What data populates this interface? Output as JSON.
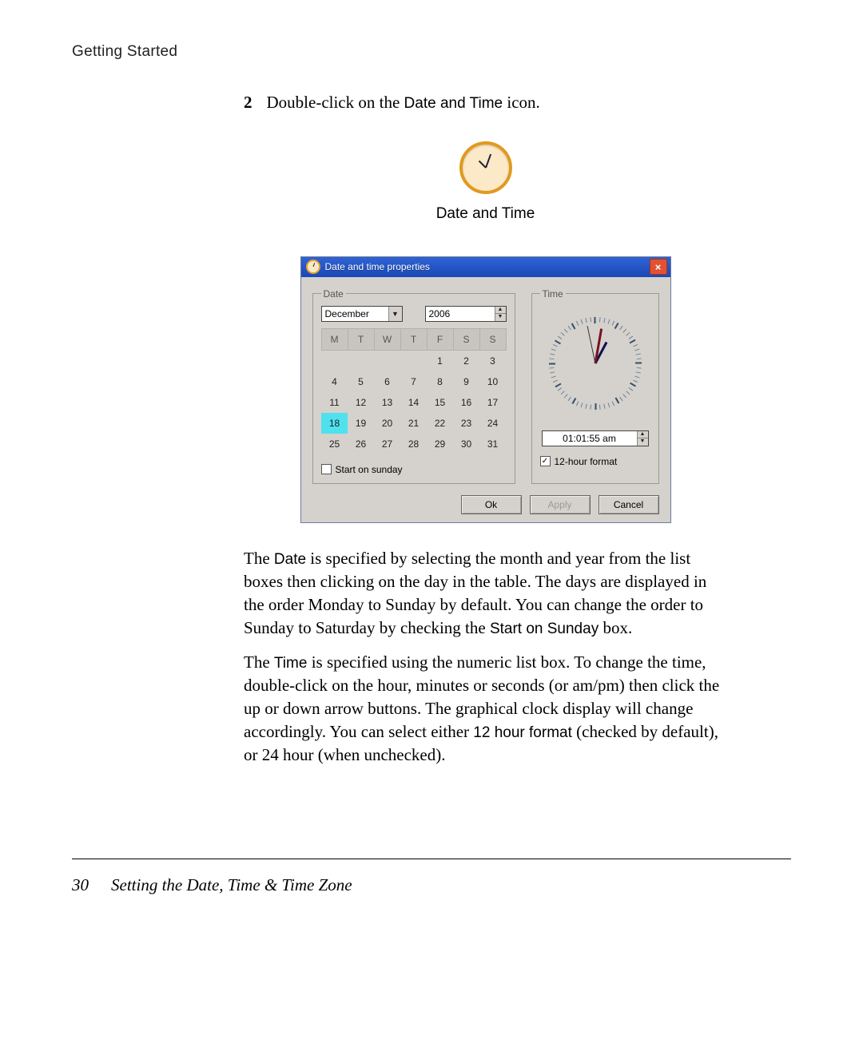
{
  "header": "Getting Started",
  "step_num": "2",
  "step_text_a": "Double-click on the ",
  "step_ui": "Date and Time",
  "step_text_b": " icon.",
  "icon_caption": "Date and Time",
  "dialog": {
    "title": "Date and time properties",
    "close": "×",
    "date_legend": "Date",
    "time_legend": "Time",
    "month": "December",
    "year": "2006",
    "dow": [
      "M",
      "T",
      "W",
      "T",
      "F",
      "S",
      "S"
    ],
    "weeks": [
      [
        "",
        "",
        "",
        "",
        "1",
        "2",
        "3"
      ],
      [
        "4",
        "5",
        "6",
        "7",
        "8",
        "9",
        "10"
      ],
      [
        "11",
        "12",
        "13",
        "14",
        "15",
        "16",
        "17"
      ],
      [
        "18",
        "19",
        "20",
        "21",
        "22",
        "23",
        "24"
      ],
      [
        "25",
        "26",
        "27",
        "28",
        "29",
        "30",
        "31"
      ]
    ],
    "selected_day": "18",
    "start_sunday_label": "Start on sunday",
    "start_sunday_checked": false,
    "time_value": "01:01:55 am",
    "twelve_label": "12-hour format",
    "twelve_checked": true,
    "ok": "Ok",
    "apply": "Apply",
    "cancel": "Cancel"
  },
  "p1_a": "The ",
  "p1_ui1": "Date",
  "p1_b": " is specified by selecting the month and year from the list boxes then clicking on the day in the table. The days are displayed in the order Monday to Sunday by default. You can change the order to Sunday to Saturday by checking the ",
  "p1_ui2": "Start on Sunday",
  "p1_c": " box.",
  "p2_a": "The ",
  "p2_ui1": "Time",
  "p2_b": " is specified using the numeric list box. To change the time, double-click on the hour, minutes or seconds (or am/pm) then click the up or down arrow buttons. The graphical clock display will change accordingly. You can select either ",
  "p2_ui2": "12 hour format",
  "p2_c": " (checked by default), or 24 hour (when unchecked).",
  "page_number": "30",
  "footer_title": "Setting the Date, Time & Time Zone"
}
